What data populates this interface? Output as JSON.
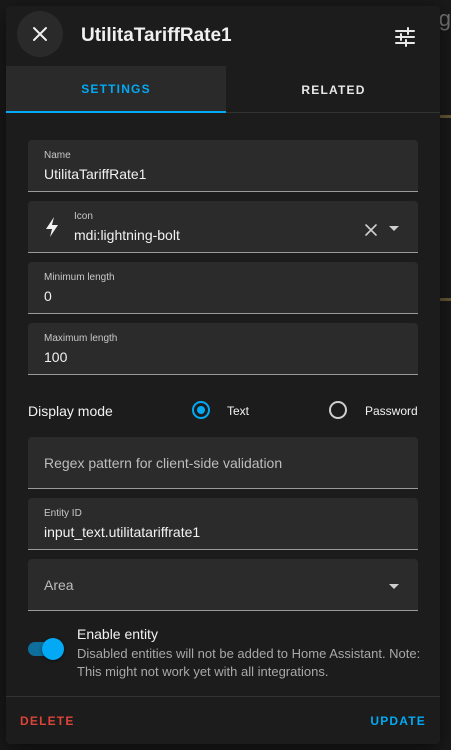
{
  "dialog": {
    "title": "UtilitaTariffRate1",
    "close_icon": "close-icon",
    "settings_icon": "tune-icon"
  },
  "tabs": [
    {
      "label": "SETTINGS",
      "active": true
    },
    {
      "label": "RELATED",
      "active": false
    }
  ],
  "fields": {
    "name": {
      "label": "Name",
      "value": "UtilitaTariffRate1"
    },
    "icon": {
      "label": "Icon",
      "value": "mdi:lightning-bolt",
      "icon": "lightning-bolt-icon"
    },
    "min_length": {
      "label": "Minimum length",
      "value": "0"
    },
    "max_length": {
      "label": "Maximum length",
      "value": "100"
    },
    "regex": {
      "placeholder": "Regex pattern for client-side validation",
      "value": ""
    },
    "entity_id": {
      "label": "Entity ID",
      "value": "input_text.utilitatariffrate1"
    },
    "area": {
      "placeholder": "Area",
      "value": ""
    }
  },
  "display_mode": {
    "label": "Display mode",
    "options": [
      {
        "label": "Text",
        "selected": true
      },
      {
        "label": "Password",
        "selected": false
      }
    ]
  },
  "enable_entity": {
    "title": "Enable entity",
    "description": "Disabled entities will not be added to Home Assistant. Note: This might not work yet with all integrations.",
    "enabled": true
  },
  "footer": {
    "delete_label": "DELETE",
    "update_label": "UPDATE"
  },
  "colors": {
    "accent": "#03a9f4",
    "danger": "#db4437",
    "surface": "#1c1c1c",
    "field": "#2b2b2b"
  }
}
